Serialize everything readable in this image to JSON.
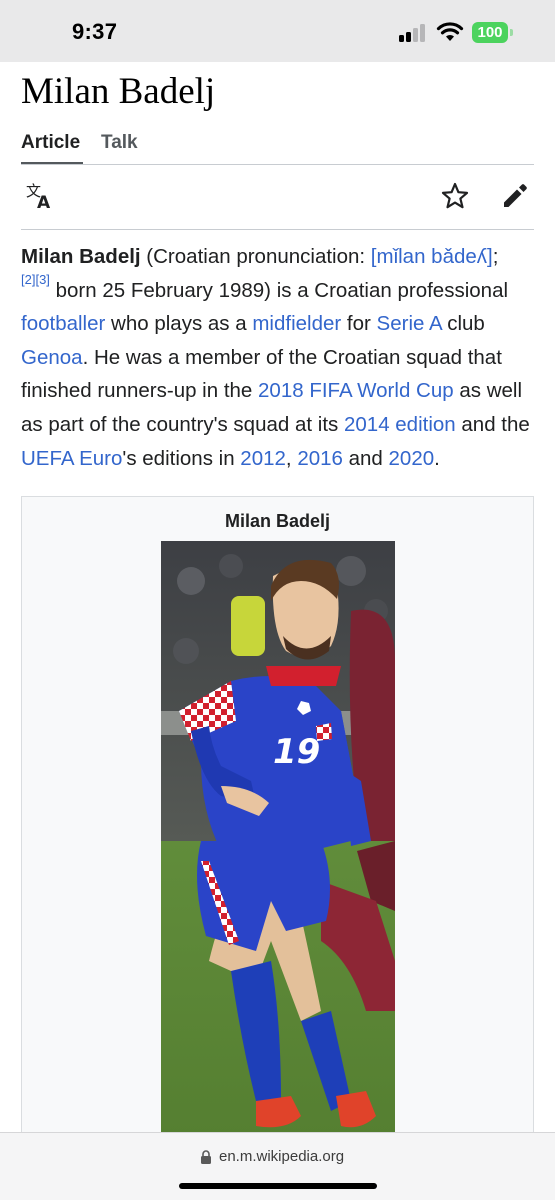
{
  "status_bar": {
    "time": "9:37",
    "battery": "100",
    "icons": [
      "cellular-signal-icon",
      "wifi-icon",
      "battery-icon"
    ]
  },
  "article": {
    "title": "Milan Badelj",
    "tabs": [
      {
        "label": "Article",
        "active": true
      },
      {
        "label": "Talk",
        "active": false
      }
    ],
    "toolbar_icons": [
      "language-icon",
      "star-icon",
      "edit-pencil-icon"
    ],
    "lead": {
      "subject": "Milan Badelj",
      "t1": " (Croatian pronunciation: ",
      "ipa": "[mǐlan bǎdeʎ]",
      "t2": ";",
      "ref2": "[2]",
      "ref3": "[3]",
      "t3": " born 25 February 1989) is a Croatian professional ",
      "link_footballer": "footballer",
      "t4": " who plays as a ",
      "link_midfielder": "midfielder",
      "t5": " for ",
      "link_serie_a": "Serie A",
      "t6": " club ",
      "link_genoa": "Genoa",
      "t7": ". He was a member of the Croatian squad that finished runners-up in the ",
      "link_world_cup_2018": "2018 FIFA World Cup",
      "t8": " as well as part of the country's squad at its ",
      "link_2014_edition": "2014 edition",
      "t9": " and the ",
      "link_uefa_euro": "UEFA Euro",
      "t10": "'s editions in ",
      "link_2012": "2012",
      "t11": ", ",
      "link_2016": "2016",
      "t12": " and ",
      "link_2020": "2020",
      "t13": "."
    },
    "infobox": {
      "title": "Milan Badelj",
      "jersey_number": "19"
    }
  },
  "browser": {
    "url": "en.m.wikipedia.org"
  },
  "colors": {
    "link": "#3366cc",
    "battery": "#4cd35e",
    "status_bar_bg": "#e9e9ea",
    "jersey_blue": "#2a44c8",
    "checker_red": "#d2202e",
    "pitch_green": "#5f8f3a"
  }
}
